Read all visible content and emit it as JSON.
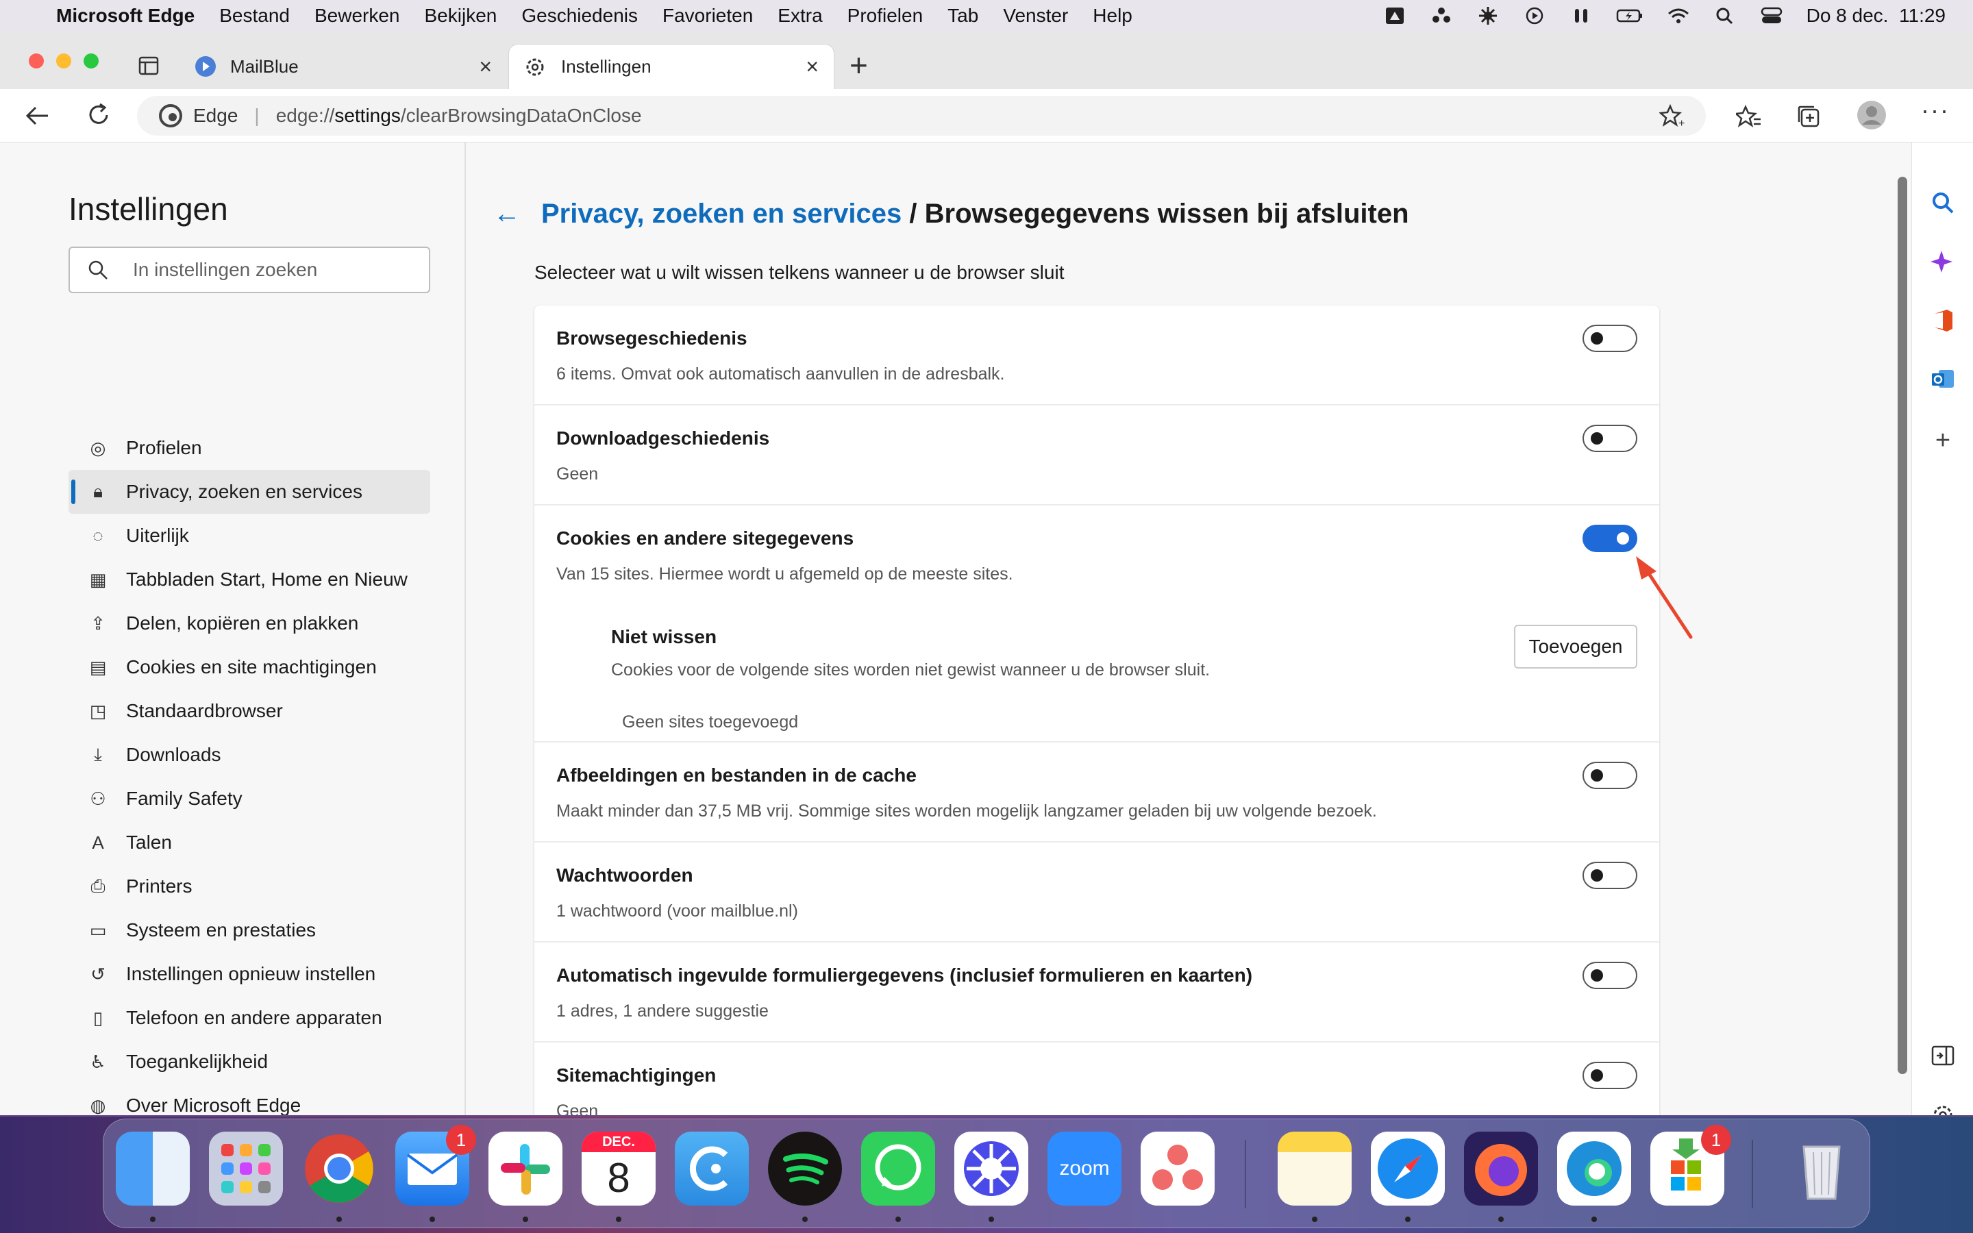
{
  "menubar": {
    "app": "Microsoft Edge",
    "items": [
      "Bestand",
      "Bewerken",
      "Bekijken",
      "Geschiedenis",
      "Favorieten",
      "Extra",
      "Profielen",
      "Tab",
      "Venster",
      "Help"
    ],
    "clock": "Do 8 dec.  11:29"
  },
  "tabs": [
    {
      "label": "MailBlue",
      "icon": "mailblue-icon"
    },
    {
      "label": "Instellingen",
      "icon": "gear-icon"
    }
  ],
  "address": {
    "brand": "Edge",
    "prefix": "edge://",
    "bold": "settings",
    "suffix": "/clearBrowsingDataOnClose"
  },
  "sidebar": {
    "title": "Instellingen",
    "search_placeholder": "In instellingen zoeken",
    "items": [
      {
        "label": "Profielen",
        "icon": "profile-icon"
      },
      {
        "label": "Privacy, zoeken en services",
        "icon": "lock-icon"
      },
      {
        "label": "Uiterlijk",
        "icon": "palette-icon"
      },
      {
        "label": "Tabbladen Start, Home en Nieuw",
        "icon": "tabs-icon"
      },
      {
        "label": "Delen, kopiëren en plakken",
        "icon": "share-icon"
      },
      {
        "label": "Cookies en site machtigingen",
        "icon": "cookie-icon"
      },
      {
        "label": "Standaardbrowser",
        "icon": "browser-icon"
      },
      {
        "label": "Downloads",
        "icon": "download-icon"
      },
      {
        "label": "Family Safety",
        "icon": "family-icon"
      },
      {
        "label": "Talen",
        "icon": "language-icon"
      },
      {
        "label": "Printers",
        "icon": "printer-icon"
      },
      {
        "label": "Systeem en prestaties",
        "icon": "laptop-icon"
      },
      {
        "label": "Instellingen opnieuw instellen",
        "icon": "reset-icon"
      },
      {
        "label": "Telefoon en andere apparaten",
        "icon": "phone-icon"
      },
      {
        "label": "Toegankelijkheid",
        "icon": "accessibility-icon"
      },
      {
        "label": "Over Microsoft Edge",
        "icon": "edge-icon"
      }
    ]
  },
  "breadcrumb": {
    "parent": "Privacy, zoeken en services",
    "sep": " / ",
    "current": "Browsegegevens wissen bij afsluiten"
  },
  "subtitle": "Selecteer wat u wilt wissen telkens wanneer u de browser sluit",
  "rows": [
    {
      "title": "Browsegeschiedenis",
      "desc": "6 items. Omvat ook automatisch aanvullen in de adresbalk.",
      "on": false
    },
    {
      "title": "Downloadgeschiedenis",
      "desc": "Geen",
      "on": false
    },
    {
      "title": "Cookies en andere sitegegevens",
      "desc": "Van 15 sites. Hiermee wordt u afgemeld op de meeste sites.",
      "on": true
    },
    {
      "title": "Afbeeldingen en bestanden in de cache",
      "desc": "Maakt minder dan 37,5 MB vrij. Sommige sites worden mogelijk langzamer geladen bij uw volgende bezoek.",
      "on": false
    },
    {
      "title": "Wachtwoorden",
      "desc": "1 wachtwoord (voor mailblue.nl)",
      "on": false
    },
    {
      "title": "Automatisch ingevulde formuliergegevens (inclusief formulieren en kaarten)",
      "desc": "1 adres, 1 andere suggestie",
      "on": false
    },
    {
      "title": "Sitemachtigingen",
      "desc": "Geen",
      "on": false
    }
  ],
  "exceptions": {
    "title": "Niet wissen",
    "desc": "Cookies voor de volgende sites worden niet gewist wanneer u de browser sluit.",
    "button": "Toevoegen",
    "empty": "Geen sites toegevoegd"
  },
  "dock": {
    "calendar_month": "DEC.",
    "calendar_day": "8",
    "zoom_label": "zoom",
    "badges": [
      "1",
      "1"
    ]
  },
  "colors": {
    "accent": "#0f6cbd",
    "toggle_on": "#1e6ad8",
    "annotation_arrow": "#e8472e"
  }
}
